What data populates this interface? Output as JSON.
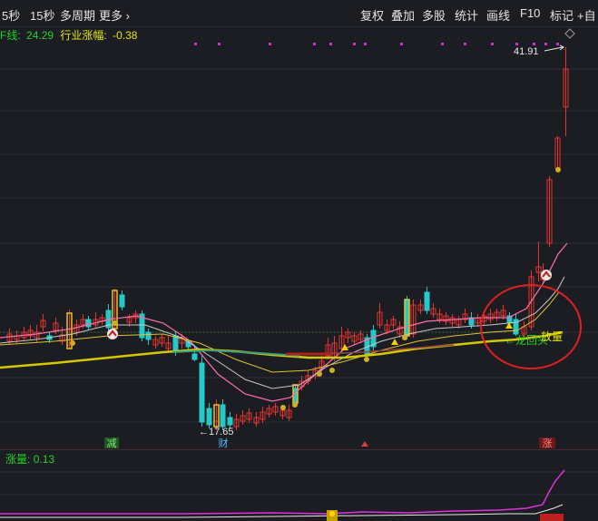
{
  "toolbar": {
    "period_items": [
      "5秒",
      "15秒",
      "多周期",
      "更多 ›"
    ],
    "right_items": [
      "复权",
      "叠加",
      "多股",
      "统计",
      "画线",
      "F10",
      "标记",
      "+自"
    ]
  },
  "legend": {
    "ma_label": "F线:",
    "ma_value": "24.29",
    "industry_label": "行业涨幅:",
    "industry_value": "-0.38"
  },
  "sub_legend": {
    "label": "涨量:",
    "value": "0.13"
  },
  "annotations": {
    "high": "41.91",
    "low": "←17.65",
    "dragon": "←龙回头",
    "volume": "放量",
    "markers": [
      "减",
      "财",
      "涨"
    ]
  },
  "colors": {
    "background": "#1b1d22",
    "up": "#e8332f",
    "down": "#24c9c9",
    "ma_short": "#e8e8e8",
    "ma_mid": "#ffd700",
    "ma_long": "#ff6eaa",
    "ma_slow": "#d4c800",
    "highlight_circle": "#e02020",
    "volume_line": "#e030e0",
    "legend_green": "#23d123",
    "legend_yellow": "#e6e600"
  },
  "chart_data": {
    "type": "candlestick",
    "high_price": 41.91,
    "low_price": 17.65,
    "indicator_value": 0.13
  }
}
